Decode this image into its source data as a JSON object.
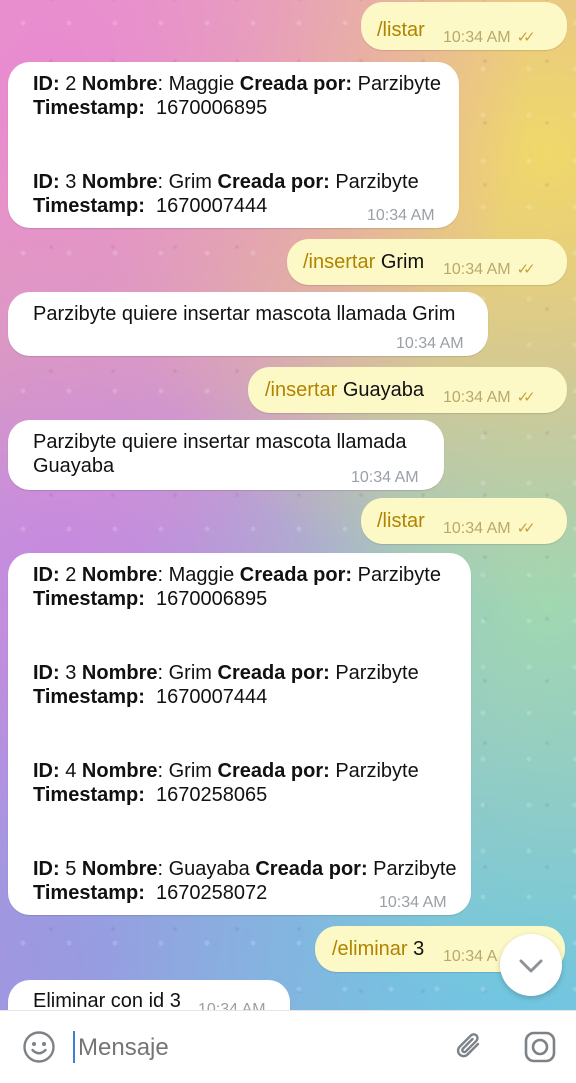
{
  "chat": {
    "messages": [
      {
        "id": "m1",
        "dir": "out",
        "cmd": "/listar",
        "arg": "",
        "time": "10:34 AM",
        "read": true
      },
      {
        "id": "m2",
        "dir": "in",
        "records": [
          {
            "id_label": "ID:",
            "id": "2",
            "name_label": "Nombre",
            "name": "Maggie",
            "by_label": "Creada por:",
            "by": "Parzibyte",
            "ts_label": "Timestamp:",
            "ts": "1670006895"
          },
          {
            "id_label": "ID:",
            "id": "3",
            "name_label": "Nombre",
            "name": "Grim",
            "by_label": "Creada por:",
            "by": "Parzibyte",
            "ts_label": "Timestamp:",
            "ts": "1670007444"
          }
        ],
        "time": "10:34 AM"
      },
      {
        "id": "m3",
        "dir": "out",
        "cmd": "/insertar",
        "arg": "Grim",
        "time": "10:34 AM",
        "read": true
      },
      {
        "id": "m4",
        "dir": "in",
        "text": "Parzibyte quiere insertar mascota llamada Grim",
        "time": "10:34 AM"
      },
      {
        "id": "m5",
        "dir": "out",
        "cmd": "/insertar",
        "arg": "Guayaba",
        "time": "10:34 AM",
        "read": true
      },
      {
        "id": "m6",
        "dir": "in",
        "text_line1": "Parzibyte quiere insertar mascota llamada",
        "text_line2": "Guayaba",
        "time": "10:34 AM"
      },
      {
        "id": "m7",
        "dir": "out",
        "cmd": "/listar",
        "arg": "",
        "time": "10:34 AM",
        "read": true
      },
      {
        "id": "m8",
        "dir": "in",
        "records": [
          {
            "id_label": "ID:",
            "id": "2",
            "name_label": "Nombre",
            "name": "Maggie",
            "by_label": "Creada por:",
            "by": "Parzibyte",
            "ts_label": "Timestamp:",
            "ts": "1670006895"
          },
          {
            "id_label": "ID:",
            "id": "3",
            "name_label": "Nombre",
            "name": "Grim",
            "by_label": "Creada por:",
            "by": "Parzibyte",
            "ts_label": "Timestamp:",
            "ts": "1670007444"
          },
          {
            "id_label": "ID:",
            "id": "4",
            "name_label": "Nombre",
            "name": "Grim",
            "by_label": "Creada por:",
            "by": "Parzibyte",
            "ts_label": "Timestamp:",
            "ts": "1670258065"
          },
          {
            "id_label": "ID:",
            "id": "5",
            "name_label": "Nombre",
            "name": "Guayaba",
            "by_label": "Creada por:",
            "by": "Parzibyte",
            "ts_label": "Timestamp:",
            "ts": "1670258072"
          }
        ],
        "time": "10:34 AM"
      },
      {
        "id": "m9",
        "dir": "out",
        "cmd": "/eliminar",
        "arg": "3",
        "time": "10:34 A",
        "read": false
      },
      {
        "id": "m10",
        "dir": "in",
        "text": "Eliminar con id 3",
        "time": "10:34 AM"
      }
    ]
  },
  "input": {
    "placeholder": "Mensaje"
  },
  "icons": {
    "emoji": "emoji-icon",
    "attach": "paperclip-icon",
    "camera": "instagram-camera-icon",
    "scroll": "chevron-down-icon",
    "read": "double-check-icon"
  },
  "colors": {
    "outgoing_bubble": "#fdf9c6",
    "incoming_bubble": "#ffffff",
    "command_text": "#b08400",
    "caret": "#3d7fd6"
  }
}
